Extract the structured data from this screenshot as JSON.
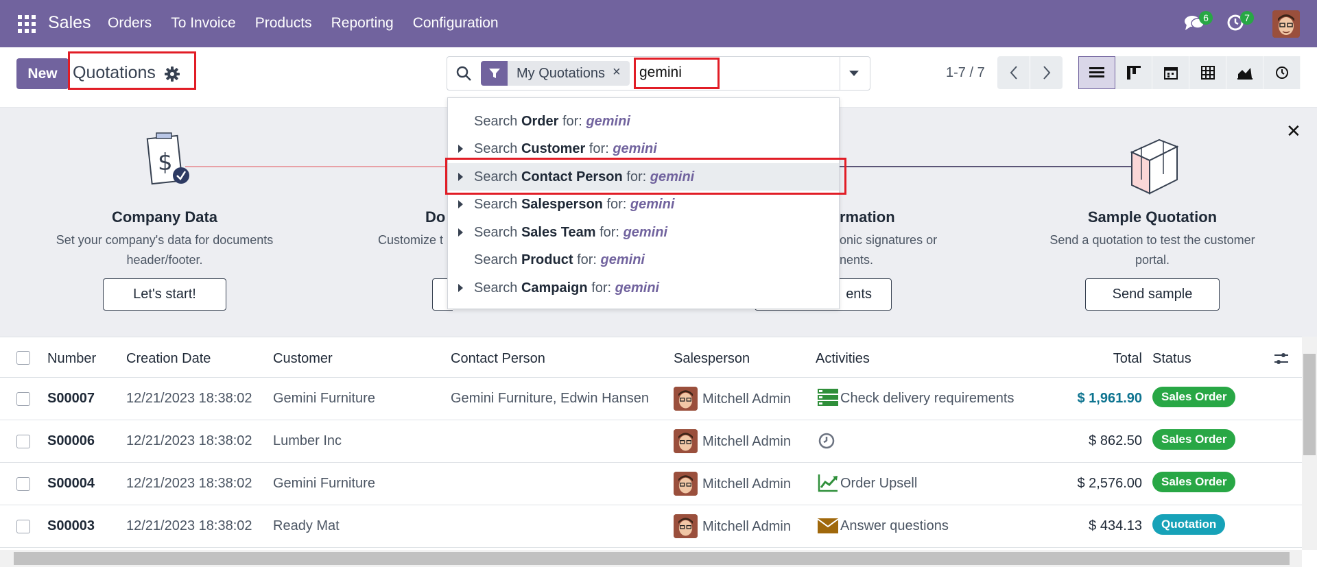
{
  "navbar": {
    "brand": "Sales",
    "menu": [
      "Orders",
      "To Invoice",
      "Products",
      "Reporting",
      "Configuration"
    ],
    "chat_count": "6",
    "activity_count": "7",
    "accent": "#71639e"
  },
  "control": {
    "new_label": "New",
    "breadcrumb": "Quotations",
    "facet_label": "My Quotations",
    "search_value": "gemini",
    "pager": "1-7 / 7"
  },
  "dropdown": {
    "items": [
      {
        "prefix": "Search",
        "field": "Order",
        "suffix": "for:",
        "term": "gemini",
        "expandable": false
      },
      {
        "prefix": "Search",
        "field": "Customer",
        "suffix": "for:",
        "term": "gemini",
        "expandable": true
      },
      {
        "prefix": "Search",
        "field": "Contact Person",
        "suffix": "for:",
        "term": "gemini",
        "expandable": true
      },
      {
        "prefix": "Search",
        "field": "Salesperson",
        "suffix": "for:",
        "term": "gemini",
        "expandable": true
      },
      {
        "prefix": "Search",
        "field": "Sales Team",
        "suffix": "for:",
        "term": "gemini",
        "expandable": true
      },
      {
        "prefix": "Search",
        "field": "Product",
        "suffix": "for:",
        "term": "gemini",
        "expandable": false
      },
      {
        "prefix": "Search",
        "field": "Campaign",
        "suffix": "for:",
        "term": "gemini",
        "expandable": true
      }
    ]
  },
  "onboarding": {
    "steps": [
      {
        "title": "Company Data",
        "desc1": "Set your company's data for documents",
        "desc2": "header/footer.",
        "button": "Let's start!"
      },
      {
        "title": "Do",
        "desc1": "Customize t",
        "desc2": "",
        "button": ""
      },
      {
        "title": "rmation",
        "desc1": "onic signatures or",
        "desc2": "nents.",
        "button": "ents"
      },
      {
        "title": "Sample Quotation",
        "desc1": "Send a quotation to test the customer",
        "desc2": "portal.",
        "button": "Send sample"
      }
    ]
  },
  "table": {
    "headers": [
      "Number",
      "Creation Date",
      "Customer",
      "Contact Person",
      "Salesperson",
      "Activities",
      "Total",
      "Status"
    ],
    "rows": [
      {
        "number": "S00007",
        "date": "12/21/2023 18:38:02",
        "customer": "Gemini Furniture",
        "contact": "Gemini Furniture, Edwin Hansen",
        "salesperson": "Mitchell Admin",
        "activity": "Check delivery requirements",
        "activity_icon": "checklist-icon",
        "total": "$ 1,961.90",
        "status": "Sales Order"
      },
      {
        "number": "S00006",
        "date": "12/21/2023 18:38:02",
        "customer": "Lumber Inc",
        "contact": "",
        "salesperson": "Mitchell Admin",
        "activity": "",
        "activity_icon": "clock-icon",
        "total": "$ 862.50",
        "status": "Sales Order"
      },
      {
        "number": "S00004",
        "date": "12/21/2023 18:38:02",
        "customer": "Gemini Furniture",
        "contact": "",
        "salesperson": "Mitchell Admin",
        "activity": "Order Upsell",
        "activity_icon": "chart-up-icon",
        "total": "$ 2,576.00",
        "status": "Sales Order"
      },
      {
        "number": "S00003",
        "date": "12/21/2023 18:38:02",
        "customer": "Ready Mat",
        "contact": "",
        "salesperson": "Mitchell Admin",
        "activity": "Answer questions",
        "activity_icon": "envelope-icon",
        "total": "$ 434.13",
        "status": "Quotation"
      }
    ]
  },
  "colors": {
    "sales_order": "#28a745",
    "quotation": "#17a2b8",
    "highlight": "#e11d26",
    "total_highlight": "#0e7490"
  }
}
